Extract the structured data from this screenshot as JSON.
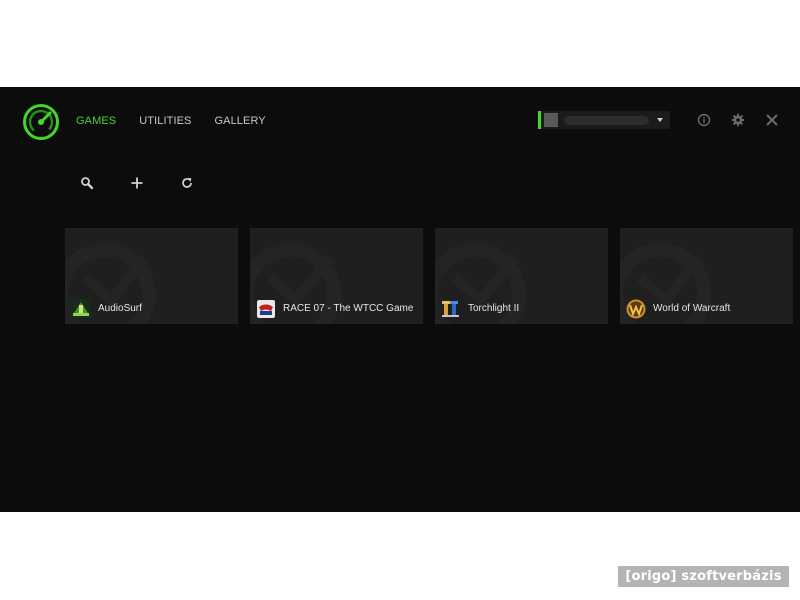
{
  "nav": {
    "tabs": [
      {
        "label": "GAMES",
        "active": true
      },
      {
        "label": "UTILITIES",
        "active": false
      },
      {
        "label": "GALLERY",
        "active": false
      }
    ]
  },
  "account": {
    "name": ""
  },
  "colors": {
    "accent": "#44d62c",
    "background": "#0c0c0c",
    "tile": "#1f1f1f"
  },
  "icons": {
    "top_right": [
      "info-icon",
      "gear-icon",
      "close-icon"
    ],
    "toolbar": [
      "search-icon",
      "plus-icon",
      "refresh-icon"
    ]
  },
  "games": [
    {
      "name": "AudioSurf",
      "icon": "audiosurf-icon"
    },
    {
      "name": "RACE 07 - The WTCC Game",
      "icon": "race07-icon"
    },
    {
      "name": "Torchlight II",
      "icon": "torchlight-icon"
    },
    {
      "name": "World of Warcraft",
      "icon": "wow-icon"
    }
  ],
  "watermark": {
    "text": "[origo] szoftverbázis"
  }
}
